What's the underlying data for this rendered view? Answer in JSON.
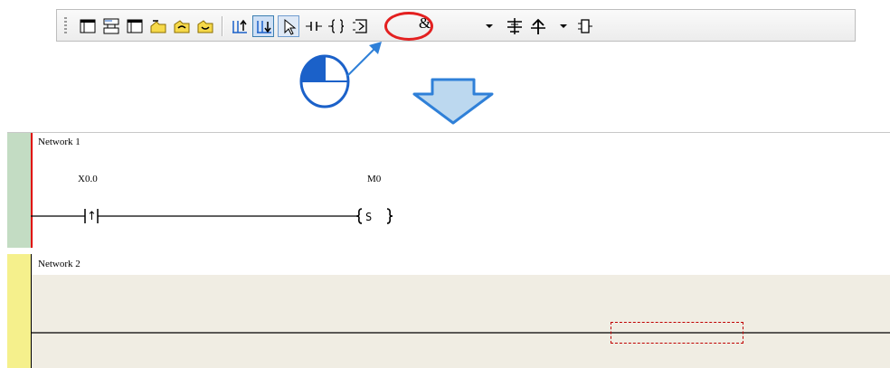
{
  "toolbar": {
    "buttons": [
      {
        "id": "new-network",
        "icon": "network-window-icon"
      },
      {
        "id": "insert-network",
        "icon": "network-split-icon"
      },
      {
        "id": "network-window-2",
        "icon": "network-window-icon"
      },
      {
        "id": "open",
        "icon": "folder-open-icon"
      },
      {
        "id": "undo-folder",
        "icon": "folder-undo-icon"
      },
      {
        "id": "redo-folder",
        "icon": "folder-redo-icon"
      },
      {
        "id": "insert-network-above",
        "icon": "insert-above-icon"
      },
      {
        "id": "insert-network-below",
        "icon": "insert-below-icon"
      },
      {
        "id": "select-mode",
        "icon": "cursor-icon"
      },
      {
        "id": "contact",
        "icon": "contact-icon"
      },
      {
        "id": "coil",
        "icon": "coil-icon"
      },
      {
        "id": "function-block",
        "icon": "function-block-icon"
      },
      {
        "id": "parallel",
        "icon": "parallel-branch-icon"
      },
      {
        "id": "up-arrow",
        "icon": "up-arrow-icon"
      },
      {
        "id": "end",
        "icon": "end-block-icon"
      }
    ],
    "logic_symbol": "&",
    "accent_highlight": "#e32020"
  },
  "ladder": {
    "network1": {
      "label": "Network 1",
      "contact_address": "X0.0",
      "coil_address": "M0",
      "contact_symbol": "↑",
      "coil_symbol": "S"
    },
    "network2": {
      "label": "Network 2"
    },
    "colors": {
      "network1_bar": "#c3dcc3",
      "network2_bar": "#f5f08c",
      "active_rail": "#e00000",
      "selection": "#c00000"
    }
  }
}
